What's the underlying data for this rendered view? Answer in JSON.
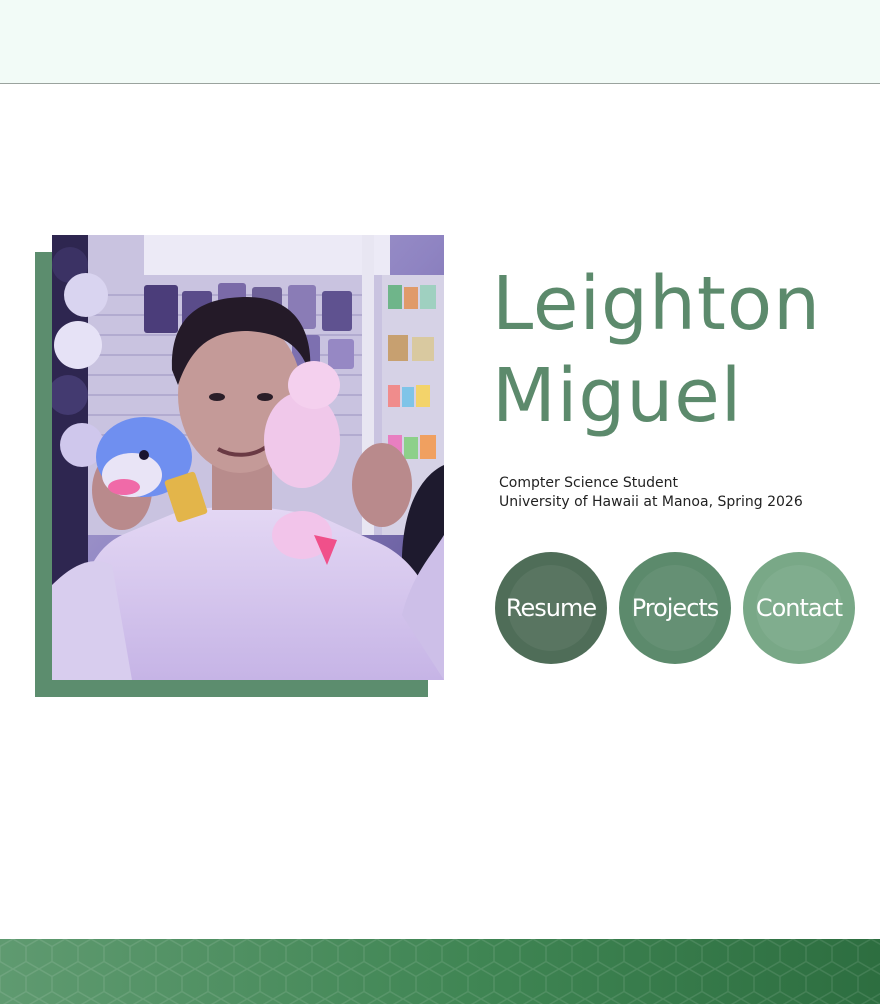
{
  "header": {},
  "hero": {
    "photo_alt": "Leighton Miguel holding two plush toys in a store",
    "name_line1": "Leighton",
    "name_line2": "Miguel",
    "subtitle_line1": "Compter Science Student",
    "subtitle_line2": "University of Hawaii at Manoa, Spring 2026"
  },
  "nav": {
    "resume": "Resume",
    "projects": "Projects",
    "contact": "Contact"
  },
  "colors": {
    "topbar_bg": "#f2fbf7",
    "accent_green": "#5c8a6c",
    "dark_green": "#4f6d58",
    "light_green": "#79a887",
    "footer_green": "#3f8553"
  }
}
